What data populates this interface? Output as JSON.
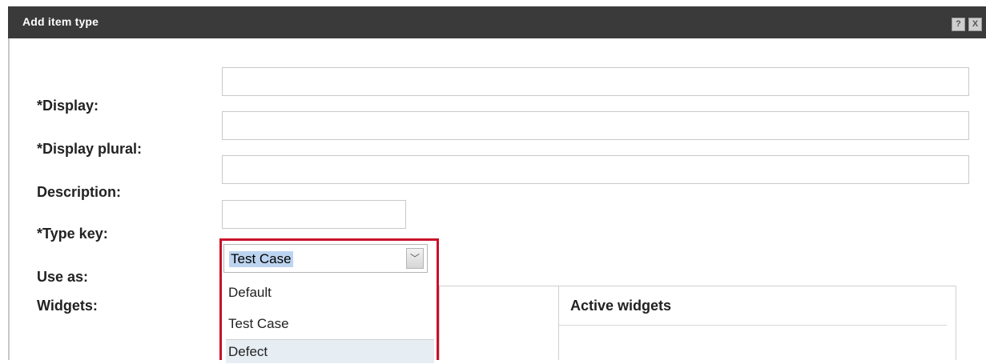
{
  "dialog": {
    "title": "Add item type",
    "help_icon_glyph": "?",
    "close_icon_glyph": "X"
  },
  "form": {
    "display_label": "*Display:",
    "display_value": "",
    "display_plural_label": "*Display plural:",
    "display_plural_value": "",
    "description_label": "Description:",
    "description_value": "",
    "type_key_label": "*Type key:",
    "type_key_value": "",
    "use_as_label": "Use as:",
    "use_as_selected": "Test Case",
    "use_as_arrow_glyph": "﹀",
    "use_as_options": [
      "Default",
      "Test Case",
      "Defect"
    ],
    "widgets_label": "Widgets:",
    "active_widgets_header": "Active widgets"
  },
  "colors": {
    "titlebar": "#3a3a3a",
    "highlight_border": "#c9102a",
    "selected_text_bg": "#bcd4f0"
  }
}
